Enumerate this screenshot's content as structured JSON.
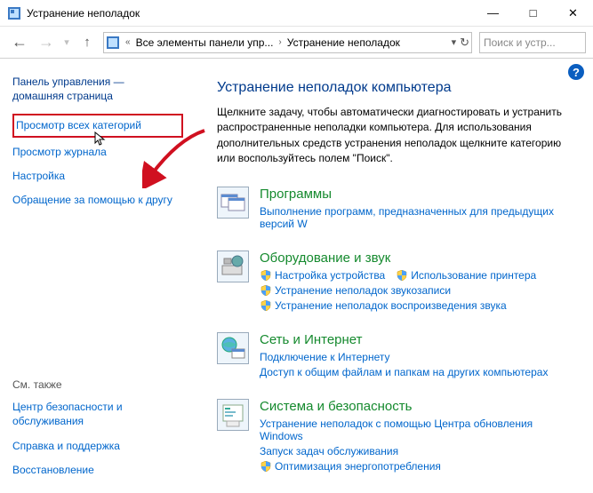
{
  "window": {
    "title": "Устранение неполадок"
  },
  "nav": {
    "crumb1": "Все элементы панели упр...",
    "crumb2": "Устранение неполадок",
    "search_placeholder": "Поиск и устр..."
  },
  "sidebar": {
    "head_line1": "Панель управления —",
    "head_line2": "домашняя страница",
    "links": {
      "view_all": "Просмотр всех категорий",
      "view_log": "Просмотр журнала",
      "settings": "Настройка",
      "ask_friend": "Обращение за помощью к другу"
    },
    "see_also": "См. также",
    "bottom": {
      "security_center": "Центр безопасности и обслуживания",
      "help": "Справка и поддержка",
      "restore": "Восстановление"
    }
  },
  "main": {
    "heading": "Устранение неполадок компьютера",
    "desc": "Щелкните задачу, чтобы автоматически диагностировать и устранить распространенные неполадки компьютера. Для использования дополнительных средств устранения неполадок щелкните категорию или воспользуйтесь полем \"Поиск\".",
    "categories": {
      "programs": {
        "title": "Программы",
        "run_old": "Выполнение программ, предназначенных для предыдущих версий W"
      },
      "hardware": {
        "title": "Оборудование и звук",
        "device": "Настройка устройства",
        "printer": "Использование принтера",
        "sound_record": "Устранение неполадок звукозаписи",
        "sound_play": "Устранение неполадок воспроизведения звука"
      },
      "network": {
        "title": "Сеть и Интернет",
        "internet": "Подключение к Интернету",
        "shares": "Доступ к общим файлам и папкам на других компьютерах"
      },
      "system": {
        "title": "Система и безопасность",
        "winupdate": "Устранение неполадок с помощью Центра обновления Windows",
        "maintenance": "Запуск задач обслуживания",
        "power": "Оптимизация энергопотребления"
      }
    }
  }
}
